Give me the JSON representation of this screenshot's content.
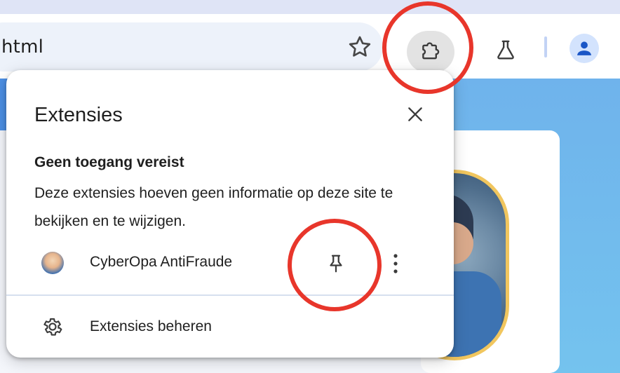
{
  "browser": {
    "omnibox_text": "html",
    "icons": [
      "star-icon",
      "puzzle-icon",
      "flask-icon",
      "account-icon"
    ]
  },
  "popup": {
    "title": "Extensies",
    "section_heading": "Geen toegang vereist",
    "section_description": "Deze extensies hoeven geen informatie op deze site te bekijken en te wijzigen.",
    "extensions": [
      {
        "name": "CyberOpa AntiFraude",
        "icon": "cyberopa-logo",
        "pin_icon": "pin-icon",
        "more_icon": "more-vert-icon"
      }
    ],
    "manage_label": "Extensies beheren",
    "manage_icon": "gear-icon"
  },
  "annotations": {
    "ring_color": "#e8362b"
  },
  "colors": {
    "toolbar_bg": "#ffffff",
    "omnibox_bg": "#edf2fa",
    "active_button_bg": "#e3e3e3",
    "avatar_bg": "#d3e3fd",
    "avatar_fg": "#1a56c6"
  }
}
